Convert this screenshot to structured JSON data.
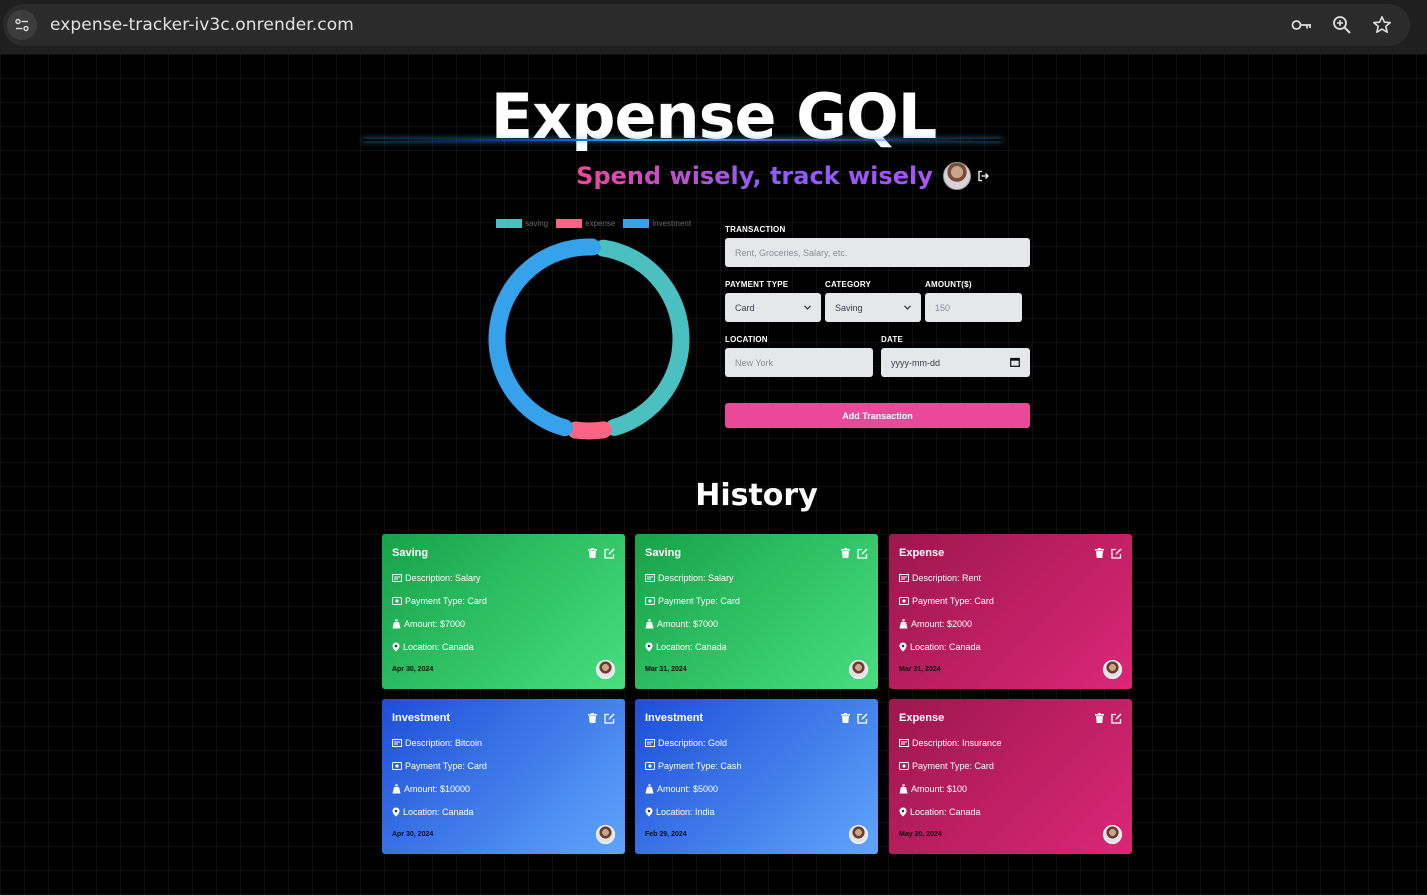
{
  "browser": {
    "url": "expense-tracker-iv3c.onrender.com"
  },
  "header": {
    "title": "Expense GQL",
    "subtitle": "Spend wisely, track wisely"
  },
  "chart_data": {
    "type": "doughnut",
    "legend": [
      "saving",
      "expense",
      "investment"
    ],
    "colors": [
      "#4bc0c0",
      "#ff6384",
      "#36a2eb"
    ],
    "values": [
      14000,
      2100,
      15000
    ],
    "legend_position": "top"
  },
  "form": {
    "transaction_label": "TRANSACTION",
    "transaction_placeholder": "Rent, Groceries, Salary, etc.",
    "payment_type_label": "PAYMENT TYPE",
    "payment_type_value": "Card",
    "category_label": "CATEGORY",
    "category_value": "Saving",
    "amount_label": "AMOUNT($)",
    "amount_placeholder": "150",
    "location_label": "LOCATION",
    "location_placeholder": "New York",
    "date_label": "DATE",
    "date_placeholder": "yyyy-mm-dd",
    "submit_label": "Add Transaction"
  },
  "history": {
    "title": "History",
    "cards": [
      {
        "category": "Saving",
        "description": "Description: Salary",
        "payment": "Payment Type: Card",
        "amount": "Amount: $7000",
        "location": "Location: Canada",
        "date": "Apr 30, 2024"
      },
      {
        "category": "Saving",
        "description": "Description: Salary",
        "payment": "Payment Type: Card",
        "amount": "Amount: $7000",
        "location": "Location: Canada",
        "date": "Mar 31, 2024"
      },
      {
        "category": "Expense",
        "description": "Description: Rent",
        "payment": "Payment Type: Card",
        "amount": "Amount: $2000",
        "location": "Location: Canada",
        "date": "Mar 31, 2024"
      },
      {
        "category": "Investment",
        "description": "Description: Bitcoin",
        "payment": "Payment Type: Card",
        "amount": "Amount: $10000",
        "location": "Location: Canada",
        "date": "Apr 30, 2024"
      },
      {
        "category": "Investment",
        "description": "Description: Gold",
        "payment": "Payment Type: Cash",
        "amount": "Amount: $5000",
        "location": "Location: India",
        "date": "Feb 29, 2024"
      },
      {
        "category": "Expense",
        "description": "Description: Insurance",
        "payment": "Payment Type: Card",
        "amount": "Amount: $100",
        "location": "Location: Canada",
        "date": "May 20, 2024"
      }
    ]
  }
}
